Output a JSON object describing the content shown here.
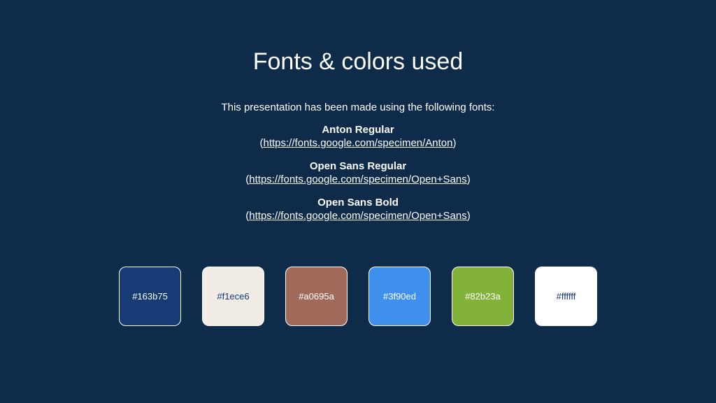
{
  "slide": {
    "title": "Fonts & colors used",
    "intro": "This presentation has been made using the following fonts:",
    "fonts": [
      {
        "name": "Anton Regular",
        "open_paren": "(",
        "url": "https://fonts.google.com/specimen/Anton",
        "close_paren": ")"
      },
      {
        "name": "Open Sans Regular",
        "open_paren": "(",
        "url": "https://fonts.google.com/specimen/Open+Sans",
        "close_paren": ")"
      },
      {
        "name": "Open Sans Bold",
        "open_paren": "(",
        "url": "https://fonts.google.com/specimen/Open+Sans",
        "close_paren": ")"
      }
    ],
    "colors": [
      {
        "label": "#163b75",
        "hex": "#163b75",
        "text_color": "#ffffff"
      },
      {
        "label": "#f1ece6",
        "hex": "#f1ece6",
        "text_color": "#163b75"
      },
      {
        "label": "#a0695a",
        "hex": "#a0695a",
        "text_color": "#ffffff"
      },
      {
        "label": "#3f90ed",
        "hex": "#3f90ed",
        "text_color": "#ffffff"
      },
      {
        "label": "#82b23a",
        "hex": "#82b23a",
        "text_color": "#ffffff"
      },
      {
        "label": "#ffffff",
        "hex": "#ffffff",
        "text_color": "#163b75"
      }
    ],
    "background": "#0e2b4a"
  }
}
